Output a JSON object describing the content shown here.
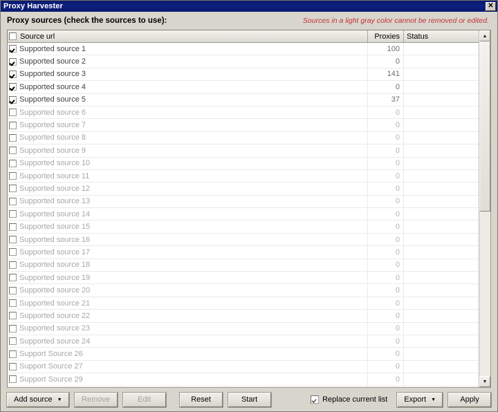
{
  "window": {
    "title": "Proxy Harvester",
    "close_label": "✕"
  },
  "header": {
    "title": "Proxy sources (check the sources to use):",
    "note": "Sources in a light gray color cannot be removed or edited."
  },
  "table": {
    "columns": [
      "Source url",
      "Proxies",
      "Status"
    ],
    "select_all_checked": false,
    "rows": [
      {
        "label": "Supported source 1",
        "proxies": "100",
        "status": "",
        "checked": true
      },
      {
        "label": "Supported source 2",
        "proxies": "0",
        "status": "",
        "checked": true
      },
      {
        "label": "Supported source 3",
        "proxies": "141",
        "status": "",
        "checked": true
      },
      {
        "label": "Supported source 4",
        "proxies": "0",
        "status": "",
        "checked": true
      },
      {
        "label": "Supported source 5",
        "proxies": "37",
        "status": "",
        "checked": true
      },
      {
        "label": "Supported source 6",
        "proxies": "0",
        "status": "",
        "checked": false
      },
      {
        "label": "Supported source 7",
        "proxies": "0",
        "status": "",
        "checked": false
      },
      {
        "label": "Supported source 8",
        "proxies": "0",
        "status": "",
        "checked": false
      },
      {
        "label": "Supported source 9",
        "proxies": "0",
        "status": "",
        "checked": false
      },
      {
        "label": "Supported source 10",
        "proxies": "0",
        "status": "",
        "checked": false
      },
      {
        "label": "Supported source 11",
        "proxies": "0",
        "status": "",
        "checked": false
      },
      {
        "label": "Supported source 12",
        "proxies": "0",
        "status": "",
        "checked": false
      },
      {
        "label": "Supported source 13",
        "proxies": "0",
        "status": "",
        "checked": false
      },
      {
        "label": "Supported source 14",
        "proxies": "0",
        "status": "",
        "checked": false
      },
      {
        "label": "Supported source 15",
        "proxies": "0",
        "status": "",
        "checked": false
      },
      {
        "label": "Supported source 16",
        "proxies": "0",
        "status": "",
        "checked": false
      },
      {
        "label": "Supported source 17",
        "proxies": "0",
        "status": "",
        "checked": false
      },
      {
        "label": "Supported source 18",
        "proxies": "0",
        "status": "",
        "checked": false
      },
      {
        "label": "Supported source 19",
        "proxies": "0",
        "status": "",
        "checked": false
      },
      {
        "label": "Supported source 20",
        "proxies": "0",
        "status": "",
        "checked": false
      },
      {
        "label": "Supported source 21",
        "proxies": "0",
        "status": "",
        "checked": false
      },
      {
        "label": "Supported source 22",
        "proxies": "0",
        "status": "",
        "checked": false
      },
      {
        "label": "Supported source 23",
        "proxies": "0",
        "status": "",
        "checked": false
      },
      {
        "label": "Supported source 24",
        "proxies": "0",
        "status": "",
        "checked": false
      },
      {
        "label": "Support Source 26",
        "proxies": "0",
        "status": "",
        "checked": false
      },
      {
        "label": "Support Source 27",
        "proxies": "0",
        "status": "",
        "checked": false
      },
      {
        "label": "Support Source 29",
        "proxies": "0",
        "status": "",
        "checked": false
      }
    ]
  },
  "scrollbar": {
    "up_arrow": "▲",
    "down_arrow": "▼"
  },
  "toolbar": {
    "add_source_label": "Add source",
    "add_source_caret": "▼",
    "remove_label": "Remove",
    "edit_label": "Edit",
    "reset_label": "Reset",
    "start_label": "Start",
    "replace_current_list_label": "Replace current list",
    "replace_current_list_checked": true,
    "export_label": "Export",
    "export_caret": "▼",
    "apply_label": "Apply"
  }
}
